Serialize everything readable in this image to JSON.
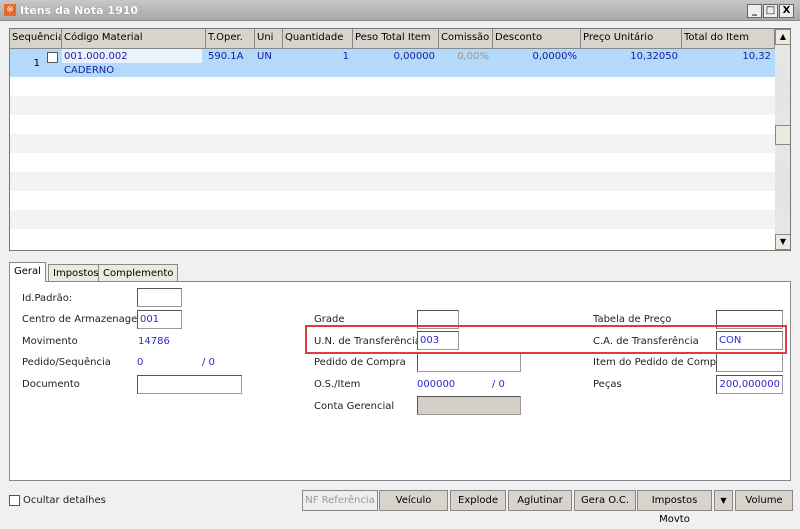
{
  "window": {
    "title": "Itens da Nota 1910",
    "controls": [
      "_",
      "□",
      "X"
    ]
  },
  "grid": {
    "columns": [
      "Sequência",
      "Código Material",
      "T.Oper.",
      "Uni",
      "Quantidade",
      "Peso Total Item",
      "Comissão",
      "Desconto",
      "Preço Unitário",
      "Total do Item"
    ],
    "rows": [
      {
        "seq": "1",
        "codigo": "001.000.002",
        "descricao": "CADERNO",
        "toper": "590.1A",
        "uni": "UN",
        "quantidade": "1",
        "peso": "0,00000",
        "comissao": "0,00%",
        "desconto": "0,0000%",
        "preco": "10,32050",
        "total": "10,32",
        "checked": false
      }
    ]
  },
  "tabs": [
    "Geral",
    "Impostos",
    "Complemento"
  ],
  "geral": {
    "id_padrao": {
      "label": "Id.Padrão:",
      "value": ""
    },
    "centro": {
      "label": "Centro de Armazenagem",
      "value": "001"
    },
    "movimento": {
      "label": "Movimento",
      "value": "14786"
    },
    "pedido_seq": {
      "label": "Pedido/Sequência",
      "value": "0",
      "value2": "/ 0"
    },
    "documento": {
      "label": "Documento",
      "value": ""
    },
    "grade": {
      "label": "Grade",
      "value": ""
    },
    "un_transf": {
      "label": "U.N. de Transferência",
      "value": "003"
    },
    "pedido_compra": {
      "label": "Pedido de Compra",
      "value": ""
    },
    "os_item": {
      "label": "O.S./Item",
      "value": "000000",
      "value2": "/ 0"
    },
    "conta": {
      "label": "Conta Gerencial",
      "value": ""
    },
    "tabela": {
      "label": "Tabela de Preço",
      "value": ""
    },
    "ca_transf": {
      "label": "C.A. de Transferência",
      "value": "CON"
    },
    "item_pedido": {
      "label": "Item do Pedido de Compra",
      "value": ""
    },
    "pecas": {
      "label": "Peças",
      "value": "200,000000"
    }
  },
  "footer": {
    "ocultar": "Ocultar detalhes",
    "buttons": [
      "NF Referência",
      "Veículo",
      "Explode",
      "Aglutinar",
      "Gera O.C.",
      "Impostos Movto",
      "▼",
      "Volume"
    ]
  },
  "colors": {
    "selected_row": "#b3d9fb",
    "highlight": "#e23b3b",
    "value_text": "#2a2acc"
  }
}
